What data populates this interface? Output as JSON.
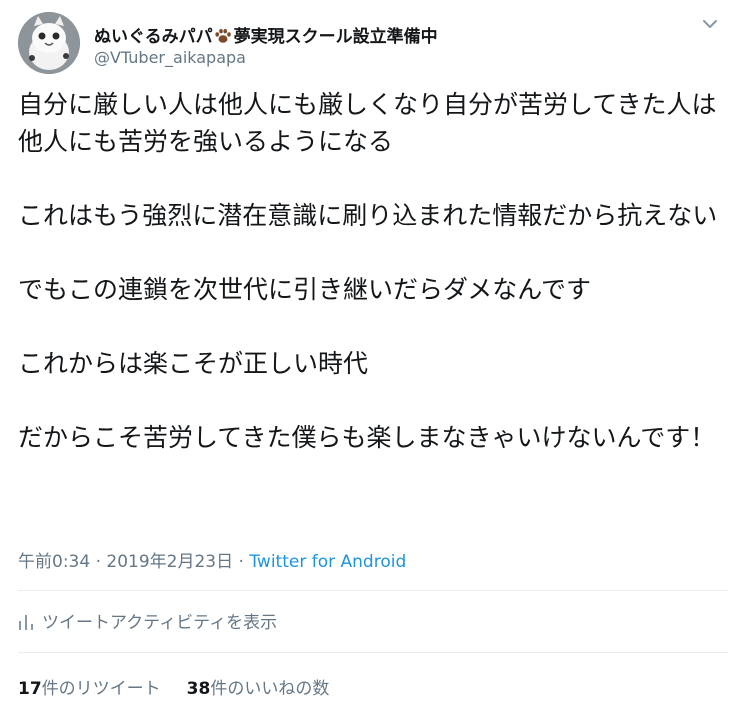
{
  "user": {
    "display_name": "ぬいぐるみパパ",
    "display_name_suffix": "夢実現スクール設立準備中",
    "handle": "@VTuber_aikapapa"
  },
  "icons": {
    "avatar": "avatar",
    "paw": "paw-icon",
    "more": "chevron-down-icon",
    "analytics": "analytics-bar-icon"
  },
  "tweet": {
    "paragraphs": [
      "自分に厳しい人は他人にも厳しくなり自分が苦労してきた人は他人にも苦労を強いるようになる",
      "これはもう強烈に潜在意識に刷り込まれた情報だから抗えない",
      "でもこの連鎖を次世代に引き継いだらダメなんです",
      "これからは楽こそが正しい時代",
      "だからこそ苦労してきた僕らも楽しまなきゃいけないんです！"
    ]
  },
  "meta": {
    "time": "午前0:34",
    "separator": " · ",
    "date": "2019年2月23日",
    "source": "Twitter for Android"
  },
  "activity": {
    "label": "ツイートアクティビティを表示"
  },
  "stats": {
    "retweets": {
      "count": "17",
      "label": "件のリツイート"
    },
    "likes": {
      "count": "38",
      "label": "件のいいねの数"
    }
  },
  "colors": {
    "text": "#14171a",
    "secondary": "#657786",
    "link": "#1b95e0",
    "divider": "#e6ecf0"
  }
}
